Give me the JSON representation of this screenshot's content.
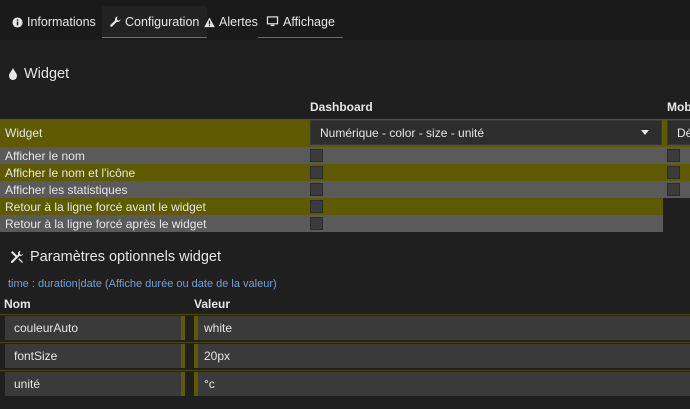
{
  "tabs": [
    {
      "label": "Informations",
      "icon": "info-circle-icon"
    },
    {
      "label": "Configuration",
      "icon": "wrench-icon"
    },
    {
      "label": "Alertes",
      "icon": "warning-triangle-icon"
    },
    {
      "label": "Affichage",
      "icon": "monitor-icon"
    }
  ],
  "widget_section": {
    "title": "Widget",
    "col_dashboard": "Dashboard",
    "col_mobile": "Mob",
    "widget_label": "Widget",
    "widget_select": "Numérique - color - size - unité",
    "widget_select_mobile": "Dé",
    "options": [
      "Afficher le nom",
      "Afficher le nom et l'icône",
      "Afficher les statistiques",
      "Retour à la ligne forcé avant le widget",
      "Retour à la ligne forcé après le widget"
    ]
  },
  "params_section": {
    "title": "Paramètres optionnels widget",
    "hint": "time : duration|date (Affiche durée ou date de la valeur)",
    "col_name": "Nom",
    "col_value": "Valeur",
    "rows": [
      {
        "name": "couleurAuto",
        "value": "white"
      },
      {
        "name": "fontSize",
        "value": "20px"
      },
      {
        "name": "unité",
        "value": "°c"
      }
    ]
  },
  "colors": {
    "accent": "#6e7a16",
    "olive": "#5e5a00",
    "row_gray": "#5a5a5a",
    "hint": "#6fa0d8"
  }
}
